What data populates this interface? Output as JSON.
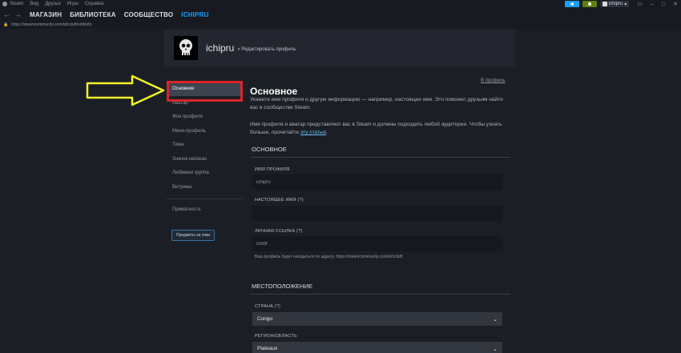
{
  "menubar": {
    "items": [
      "Steam",
      "Вид",
      "Друзья",
      "Игры",
      "Справка"
    ]
  },
  "account": {
    "name": "ichipru",
    "arrow": "▾"
  },
  "nav": {
    "store": "МАГАЗИН",
    "library": "БИБЛИОТЕКА",
    "community": "СООБЩЕСТВО",
    "user": "ICHIPRU"
  },
  "url": {
    "text": "https://steamcommunity.com/id/cclidf/edit/info"
  },
  "profile": {
    "name": "ichipru",
    "crumb": "» Редактировать профиль",
    "back_link": "В профиль"
  },
  "leftnav": {
    "items": [
      "Основное",
      "Аватар",
      "Фон профиля",
      "Мини-профиль",
      "Тема",
      "Значок напоказ",
      "Любимая группа",
      "Витрины"
    ],
    "privacy": "Приватность",
    "items_button": "Предметы за очки"
  },
  "main": {
    "title": "Основное",
    "desc1": "Укажите имя профиля и другую информацию — например, настоящее имя. Это поможет друзьям найти вас в сообществе Steam.",
    "desc2": "Имя профиля и аватар представляют вас в Steam и должны подходить любой аудитории. Чтобы узнать больше, прочитайте ",
    "desc2_link": "эту статью",
    "desc2_end": ".",
    "section_basic": "ОСНОВНОЕ",
    "profile_name_label": "ИМЯ ПРОФИЛЯ",
    "profile_name_value": "ichipru",
    "real_name_label": "НАСТОЯЩЕЕ ИМЯ (?)",
    "real_name_value": "",
    "custom_url_label": "ЛИЧНАЯ ССЫЛКА (?)",
    "custom_url_value": "cclidf",
    "custom_url_hint": "Ваш профиль будет находиться по адресу: https://steamcommunity.com/id/cclidf/",
    "section_location": "МЕСТОПОЛОЖЕНИЕ",
    "country_label": "СТРАНА (?)",
    "country_value": "Congo",
    "region_label": "РЕГИОН/ОБЛАСТЬ",
    "region_value": "Plateaux"
  },
  "colors": {
    "accent": "#1a9fff",
    "highlight": "#d8242c",
    "arrow": "#f5f02a"
  }
}
